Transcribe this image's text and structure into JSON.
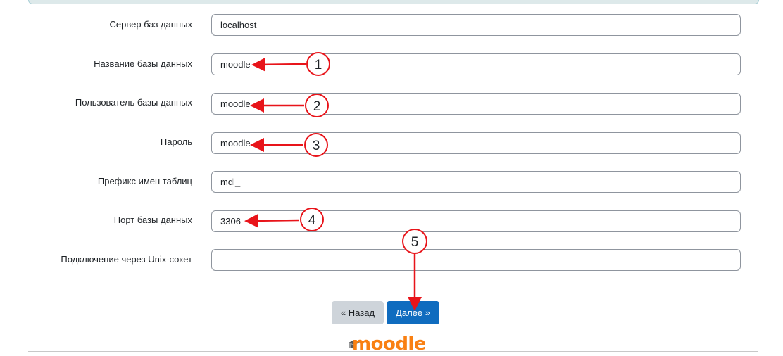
{
  "form": {
    "rows": [
      {
        "label": "Сервер баз данных",
        "value": "localhost"
      },
      {
        "label": "Название базы данных",
        "value": "moodle"
      },
      {
        "label": "Пользователь базы данных",
        "value": "moodle"
      },
      {
        "label": "Пароль",
        "value": "moodle"
      },
      {
        "label": "Префикс имен таблиц",
        "value": "mdl_"
      },
      {
        "label": "Порт базы данных",
        "value": "3306"
      },
      {
        "label": "Подключение через Unix-сокет",
        "value": ""
      }
    ]
  },
  "buttons": {
    "back_label": "« Назад",
    "next_label": "Далее »"
  },
  "logo": {
    "text": "moodle"
  },
  "annotations": {
    "markers": [
      "1",
      "2",
      "3",
      "4",
      "5"
    ],
    "color": "#e8141a"
  },
  "colors": {
    "primary": "#0f6cbf",
    "secondary": "#ced4da",
    "logo": "#f98012"
  }
}
